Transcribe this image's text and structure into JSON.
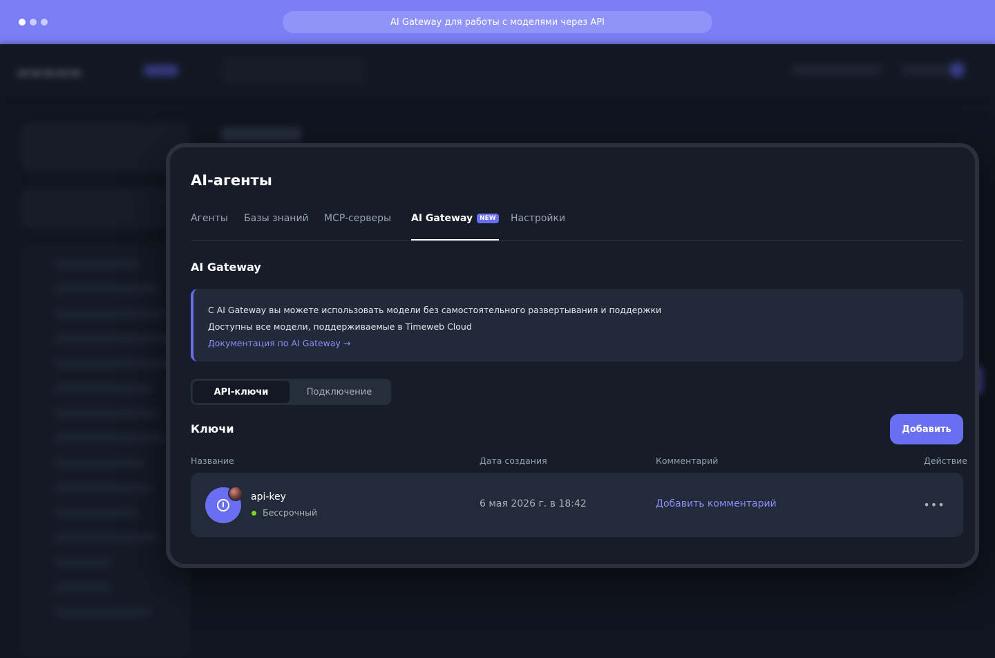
{
  "browser": {
    "url_title": "AI Gateway для работы с моделями через API"
  },
  "page": {
    "title": "AI-агенты",
    "tabs": [
      {
        "label": "Агенты"
      },
      {
        "label": "Базы знаний"
      },
      {
        "label": "MCP-серверы"
      },
      {
        "label": "AI Gateway",
        "badge": "NEW",
        "active": true
      },
      {
        "label": "Настройки"
      }
    ]
  },
  "gateway": {
    "section_title": "AI Gateway",
    "info_lines": [
      "С AI Gateway вы можете использовать модели без самостоятельного развертывания и поддержки",
      "Доступны все модели, поддерживаемые в Timeweb Cloud"
    ],
    "doc_link": "Документация по AI Gateway →",
    "segments": [
      {
        "label": "API-ключи",
        "active": true
      },
      {
        "label": "Подключение",
        "active": false
      }
    ],
    "keys_title": "Ключи",
    "add_button": "Добавить",
    "table": {
      "columns": [
        "Название",
        "Дата создания",
        "Комментарий",
        "Действие"
      ],
      "rows": [
        {
          "name": "api-key",
          "status": "Бессрочный",
          "created": "6 мая 2026 г. в 18:42",
          "comment_action": "Добавить комментарий",
          "action_icon": "more-horizontal-icon"
        }
      ]
    }
  },
  "colors": {
    "accent": "#6a6ef0",
    "link": "#8a8df9",
    "status_active": "#7ed321",
    "topbar": "#7a7df3"
  }
}
